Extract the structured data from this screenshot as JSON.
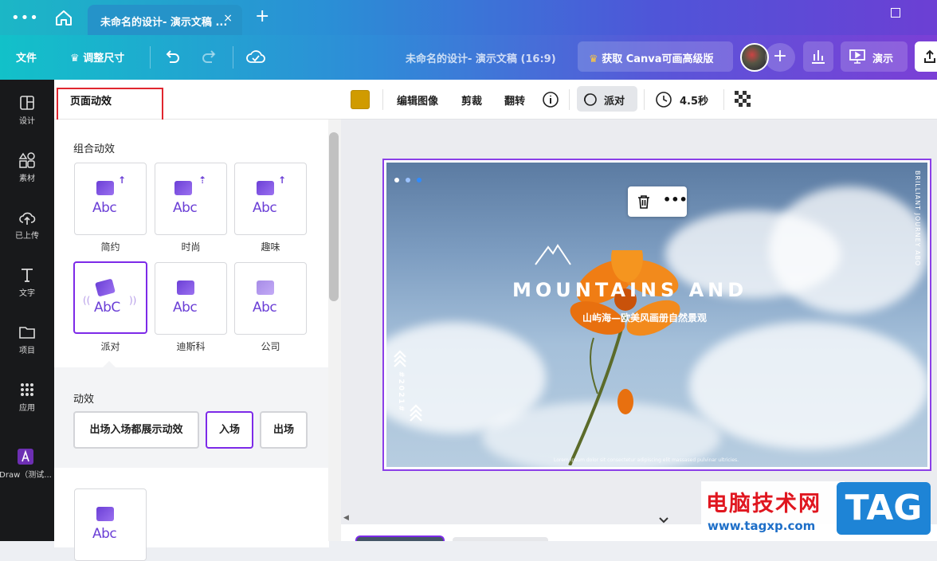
{
  "titlebar": {
    "menu_icon": "more-dots-icon",
    "home_icon": "home-icon",
    "tab_title": "未命名的设计- 演示文稿 ...",
    "tab_close": "×",
    "new_tab": "+"
  },
  "toolbar": {
    "file": "文件",
    "resize": "调整尺寸",
    "doc_title": "未命名的设计- 演示文稿 (16:9)",
    "pro_button": "获取 Canva可画高级版",
    "present": "演示",
    "add_person": "+"
  },
  "sidebar": {
    "items": [
      {
        "label": "设计",
        "icon": "layout-icon"
      },
      {
        "label": "素材",
        "icon": "shapes-icon"
      },
      {
        "label": "已上传",
        "icon": "upload-cloud-icon"
      },
      {
        "label": "文字",
        "icon": "text-icon"
      },
      {
        "label": "项目",
        "icon": "folder-icon"
      },
      {
        "label": "应用",
        "icon": "apps-grid-icon"
      },
      {
        "label": "Draw（测试...",
        "icon": "draw-app-icon"
      }
    ]
  },
  "panel": {
    "title": "页面动效",
    "combo_label": "组合动效",
    "cards": [
      {
        "label": "简约",
        "text": "Abc"
      },
      {
        "label": "时尚",
        "text": "Abc"
      },
      {
        "label": "趣味",
        "text": "Abc"
      },
      {
        "label": "派对",
        "text": "AbC"
      },
      {
        "label": "迪斯科",
        "text": "Abc"
      },
      {
        "label": "公司",
        "text": "Abc"
      }
    ],
    "selected_card": "派对",
    "effect_label": "动效",
    "effect_buttons": [
      "出场入场都展示动效",
      "入场",
      "出场"
    ],
    "selected_effect": "入场",
    "extra_card_text": "Abc"
  },
  "context_toolbar": {
    "color": "#d09b00",
    "edit_image": "编辑图像",
    "crop": "剪裁",
    "flip": "翻转",
    "info_icon": "info-icon",
    "animation": "派对",
    "duration": "4.5秒",
    "transparency_icon": "checkerboard-icon"
  },
  "slide": {
    "title": "MOUNTAINS AND",
    "subtitle": "山屿海—欧美风画册自然景观",
    "vertical_text": "BRILLIANT JOURNEY ABO",
    "year": "#2021#",
    "footer": "Lorem ipsum dolor sit consectetur adipiscing elit massased pulvinar ultricies."
  },
  "watermark": {
    "site_name": "电脑技术网",
    "url": "www.tagxp.com",
    "tag": "TAG"
  }
}
